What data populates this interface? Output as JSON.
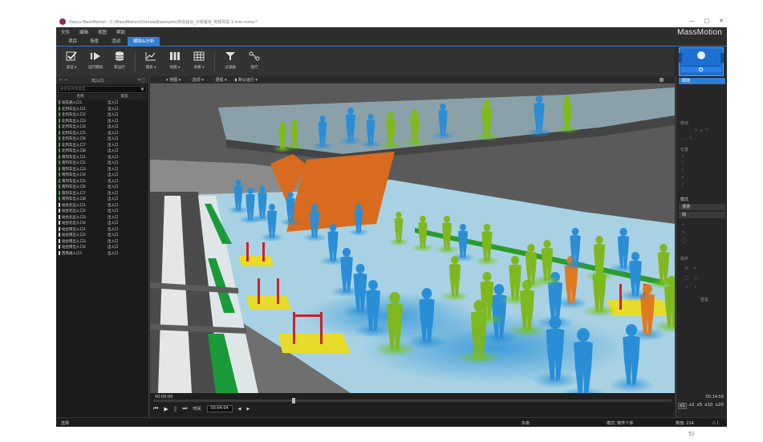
{
  "window": {
    "title": "Oasys MassMotion - C:\\MassMotion\\ChineseExamples\\列车站台_分析版本_地铁列车.1.mm.mmx *",
    "controls": [
      "—",
      "□",
      "✕"
    ]
  },
  "brand": "MassMotion",
  "menu": [
    "文件",
    "编辑",
    "视图",
    "帮助"
  ],
  "tabs": [
    {
      "label": "项目",
      "active": false
    },
    {
      "label": "场景",
      "active": false
    },
    {
      "label": "活动",
      "active": false
    },
    {
      "label": "模拟&分析",
      "active": true
    }
  ],
  "ribbon": [
    {
      "label": "验证 ▾",
      "icon": "check-icon"
    },
    {
      "label": "运行模拟",
      "icon": "run-simulation-icon"
    },
    {
      "label": "新运行",
      "icon": "database-icon"
    },
    {
      "label": "图表 ▾",
      "icon": "line-chart-icon"
    },
    {
      "label": "地图 ▾",
      "icon": "map-icon"
    },
    {
      "label": "表格 ▾",
      "icon": "table-icon"
    },
    {
      "label": "过滤器",
      "icon": "filter-icon"
    },
    {
      "label": "旅行",
      "icon": "path-icon"
    }
  ],
  "left_panel": {
    "header_title": "出入口",
    "search_placeholder": "搜索名称或类型...",
    "columns": [
      "名称",
      "类型"
    ],
    "rows": [
      {
        "name": "站前通入口1",
        "type": "出入口",
        "mark": "green"
      },
      {
        "name": "北列车出入口1",
        "type": "出入口",
        "mark": "green"
      },
      {
        "name": "北列车出入口2",
        "type": "出入口",
        "mark": "green"
      },
      {
        "name": "北列车出入口3",
        "type": "出入口",
        "mark": "green"
      },
      {
        "name": "北列车出入口4",
        "type": "出入口",
        "mark": "green"
      },
      {
        "name": "北列车出入口5",
        "type": "出入口",
        "mark": "green"
      },
      {
        "name": "北列车出入口6",
        "type": "出入口",
        "mark": "green"
      },
      {
        "name": "北列车出入口7",
        "type": "出入口",
        "mark": "green"
      },
      {
        "name": "北列车出入口8",
        "type": "出入口",
        "mark": "green"
      },
      {
        "name": "南列车出入口1",
        "type": "出入口",
        "mark": "green"
      },
      {
        "name": "南列车出入口2",
        "type": "出入口",
        "mark": "green"
      },
      {
        "name": "南列车出入口3",
        "type": "出入口",
        "mark": "green"
      },
      {
        "name": "南列车出入口4",
        "type": "出入口",
        "mark": "green"
      },
      {
        "name": "南列车出入口5",
        "type": "出入口",
        "mark": "green"
      },
      {
        "name": "南列车出入口6",
        "type": "出入口",
        "mark": "green"
      },
      {
        "name": "南列车出入口7",
        "type": "出入口",
        "mark": "green"
      },
      {
        "name": "南列车出入口8",
        "type": "出入口",
        "mark": "green"
      },
      {
        "name": "站台北出入口1",
        "type": "出入口",
        "mark": "white"
      },
      {
        "name": "站台北出入口2",
        "type": "出入口",
        "mark": "white"
      },
      {
        "name": "站台北出入口3",
        "type": "出入口",
        "mark": "white"
      },
      {
        "name": "站台北出入口4",
        "type": "出入口",
        "mark": "white"
      },
      {
        "name": "站台南出入口1",
        "type": "出入口",
        "mark": "white"
      },
      {
        "name": "站台南出入口2",
        "type": "出入口",
        "mark": "white"
      },
      {
        "name": "站台南出入口3",
        "type": "出入口",
        "mark": "white"
      },
      {
        "name": "站台南出入口4",
        "type": "出入口",
        "mark": "white"
      },
      {
        "name": "西南通入口1",
        "type": "出入口",
        "mark": "white"
      }
    ]
  },
  "view_toolbar": [
    "▾ 地图 ▾",
    "◦ 选项 ▾",
    "◦ 透视 ▾",
    "▮ 默认运行 ▾"
  ],
  "timeline": {
    "start_time": "00:00:00",
    "end_time": "00:14:59",
    "time_label": "时间",
    "current_time": "00:04:04",
    "position_fraction": 0.27
  },
  "speeds": [
    {
      "label": "x1",
      "active": true
    },
    {
      "label": "x2",
      "active": false
    },
    {
      "label": "x5",
      "active": false
    },
    {
      "label": "x10",
      "active": false
    },
    {
      "label": "x20",
      "active": false
    }
  ],
  "right_panel": {
    "follow_label": "跟随",
    "section_move": "移动",
    "section_position": "位置",
    "section_mode": "模式",
    "mode_buttons": [
      "漫游",
      "线"
    ],
    "section_actions": "操作",
    "reset_label": "重置"
  },
  "status": {
    "left": "选择",
    "mid": "东南",
    "mode": "模式: 物件个体",
    "count": "数值: 214"
  },
  "signature": "5)"
}
